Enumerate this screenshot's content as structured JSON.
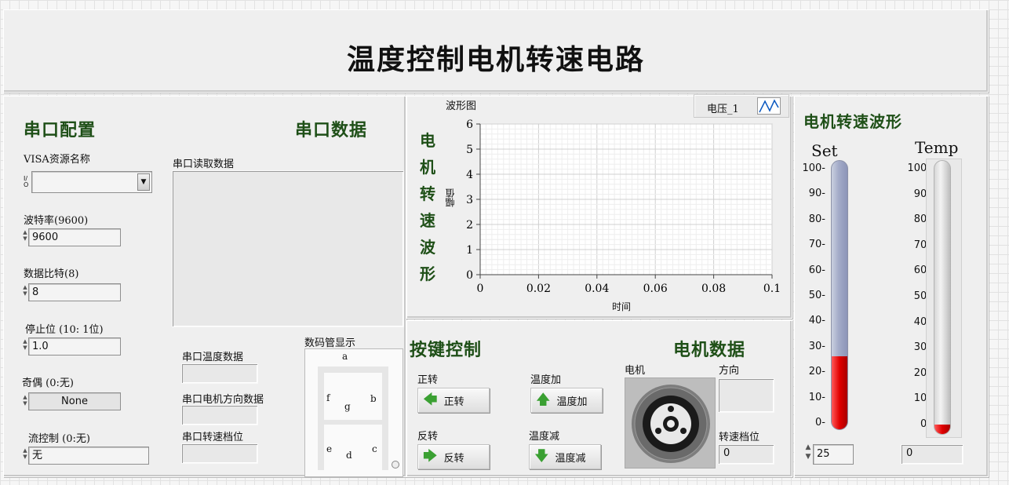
{
  "title": "温度控制电机转速电路",
  "serial_config": {
    "heading": "串口配置",
    "visa_label": "VISA资源名称",
    "visa_icon": "I/O",
    "visa_value": "",
    "baud_label": "波特率(9600)",
    "baud_value": "9600",
    "databits_label": "数据比特(8)",
    "databits_value": "8",
    "stopbits_label": "停止位 (10: 1位)",
    "stopbits_value": "1.0",
    "parity_label": "奇偶 (0:无)",
    "parity_value": "None",
    "flow_label": "流控制 (0:无)",
    "flow_value": "无"
  },
  "serial_data": {
    "heading": "串口数据",
    "read_label": "串口读取数据",
    "read_value": "",
    "temp_label": "串口温度数据",
    "temp_value": "",
    "dir_label": "串口电机方向数据",
    "dir_value": "",
    "gear_label": "串口转速档位",
    "gear_value": ""
  },
  "seven_segment": {
    "label": "数码管显示",
    "segments": {
      "a": "a",
      "b": "b",
      "c": "c",
      "d": "d",
      "e": "e",
      "f": "f",
      "g": "g"
    }
  },
  "waveform": {
    "side_title": "电机转速波形",
    "graph_label": "波形图",
    "legend_name": "电压_1",
    "xlabel": "时间",
    "ylabel": "幅值"
  },
  "chart_data": {
    "type": "line",
    "title": "波形图",
    "xlabel": "时间",
    "ylabel": "幅值",
    "xlim": [
      0,
      0.1
    ],
    "ylim": [
      0,
      6
    ],
    "x_ticks": [
      "0",
      "0.02",
      "0.04",
      "0.06",
      "0.08",
      "0.1"
    ],
    "y_ticks": [
      "0",
      "1",
      "2",
      "3",
      "4",
      "5",
      "6"
    ],
    "series": [
      {
        "name": "电压_1",
        "x": [],
        "y": []
      }
    ],
    "grid": true,
    "legend": "top-right"
  },
  "key_control": {
    "heading": "按键控制",
    "forward_label": "正转",
    "forward_btn": "正转",
    "reverse_label": "反转",
    "reverse_btn": "反转",
    "temp_up_label": "温度加",
    "temp_up_btn": "温度加",
    "temp_down_label": "温度减",
    "temp_down_btn": "温度减"
  },
  "motor_data": {
    "heading": "电机数据",
    "motor_label": "电机",
    "direction_label": "方向",
    "direction_value": "",
    "gear_label": "转速档位",
    "gear_value": "0"
  },
  "thermometers": {
    "heading": "电机转速波形",
    "set_label": "Set",
    "set_value": 25,
    "set_display": "25",
    "temp_label": "Temp",
    "temp_value": 0,
    "temp_display": "0",
    "scale_max": 100,
    "ticks": [
      "100",
      "90",
      "80",
      "70",
      "60",
      "50",
      "40",
      "30",
      "20",
      "10",
      "0"
    ],
    "fill_color": "#e00000",
    "tube_color": "#a3abc8"
  },
  "colors": {
    "heading_green": "#1e4f17",
    "arrow_green": "#3aa032"
  }
}
